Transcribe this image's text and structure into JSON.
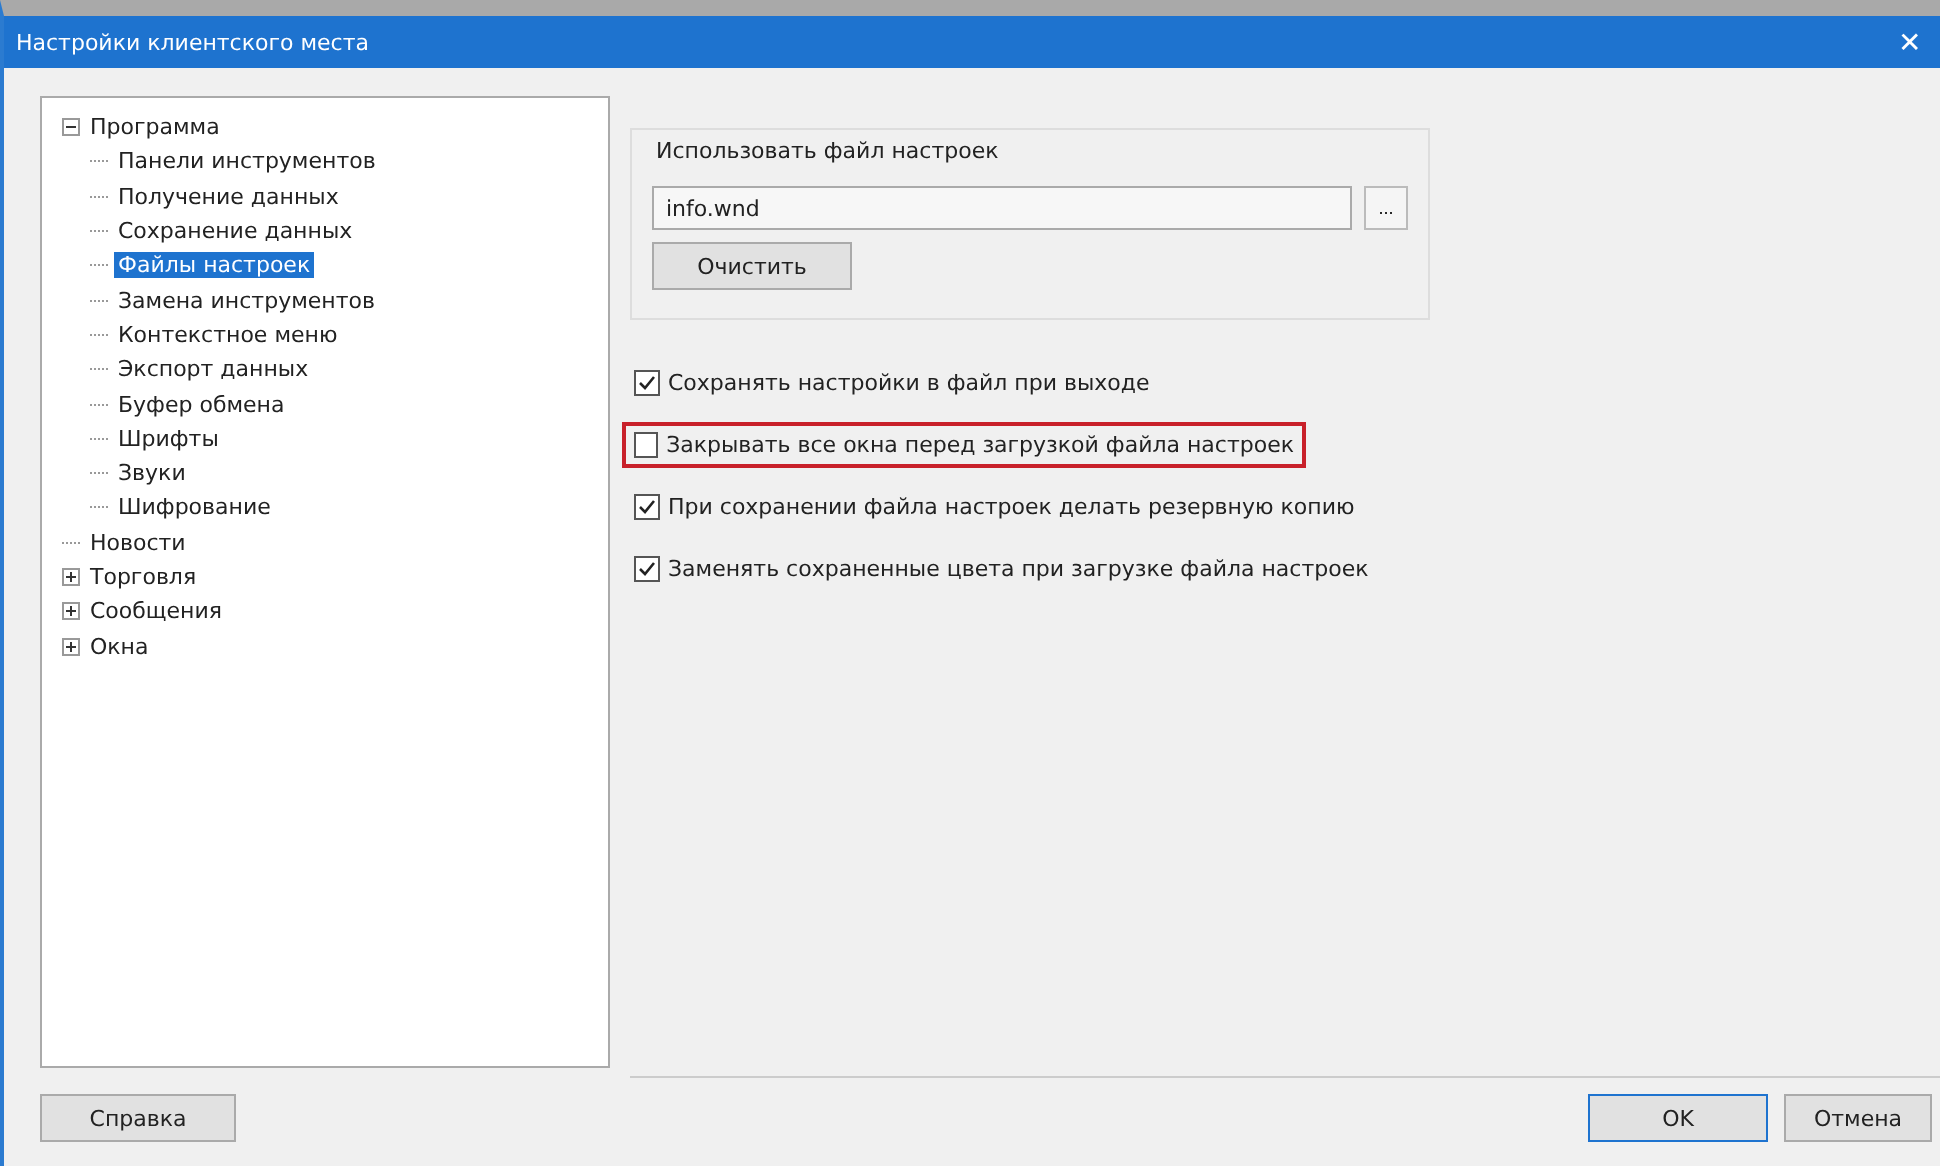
{
  "window": {
    "title": "Настройки клиентского места",
    "close": "✕"
  },
  "tree": [
    {
      "label": "Программа",
      "expanded": true,
      "selected": false,
      "children": [
        {
          "label": "Панели инструментов",
          "selected": false
        },
        {
          "label": "Получение данных",
          "selected": false
        },
        {
          "label": "Сохранение данных",
          "selected": false
        },
        {
          "label": "Файлы настроек",
          "selected": true
        },
        {
          "label": "Замена инструментов",
          "selected": false
        },
        {
          "label": "Контекстное меню",
          "selected": false
        },
        {
          "label": "Экспорт данных",
          "selected": false
        },
        {
          "label": "Буфер обмена",
          "selected": false
        },
        {
          "label": "Шрифты",
          "selected": false
        },
        {
          "label": "Звуки",
          "selected": false
        },
        {
          "label": "Шифрование",
          "selected": false
        }
      ]
    },
    {
      "label": "Новости",
      "selected": false
    },
    {
      "label": "Торговля",
      "expanded": false,
      "selected": false
    },
    {
      "label": "Сообщения",
      "expanded": false,
      "selected": false
    },
    {
      "label": "Окна",
      "expanded": false,
      "selected": false
    }
  ],
  "settings_file": {
    "legend": "Использовать файл настроек",
    "value": "info.wnd",
    "browse": "...",
    "clear": "Очистить"
  },
  "options": [
    {
      "label": "Сохранять настройки в файл при выходе",
      "checked": true,
      "highlighted": false
    },
    {
      "label": "Закрывать все окна перед загрузкой файла настроек",
      "checked": false,
      "highlighted": true
    },
    {
      "label": "При сохранении файла настроек делать резервную копию",
      "checked": true,
      "highlighted": false
    },
    {
      "label": "Заменять сохраненные цвета при загрузке файла настроек",
      "checked": true,
      "highlighted": false
    }
  ],
  "buttons": {
    "help": "Справка",
    "ok": "OK",
    "cancel": "Отмена"
  }
}
